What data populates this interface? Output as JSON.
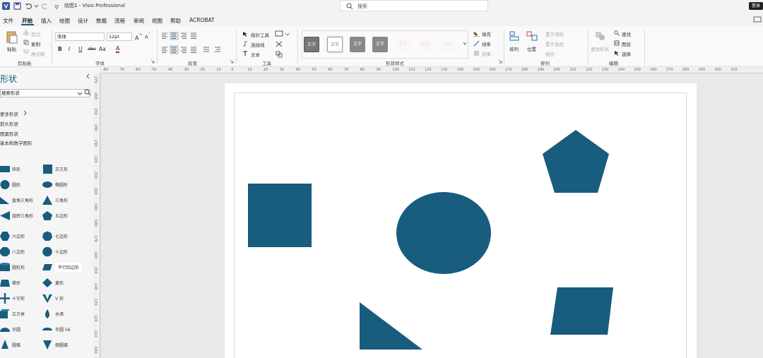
{
  "titlebar": {
    "doc_title": "绘图1 - Visio Professional",
    "search_placeholder": "搜索",
    "login": "登录"
  },
  "menu": [
    {
      "label": "文件"
    },
    {
      "label": "开始",
      "active": true
    },
    {
      "label": "插入"
    },
    {
      "label": "绘图"
    },
    {
      "label": "设计"
    },
    {
      "label": "数据"
    },
    {
      "label": "流程"
    },
    {
      "label": "审阅"
    },
    {
      "label": "视图"
    },
    {
      "label": "帮助"
    },
    {
      "label": "ACROBAT"
    }
  ],
  "ribbon": {
    "clipboard": {
      "paste": "粘贴",
      "cut": "剪切",
      "copy": "复制",
      "format_painter": "格式刷",
      "label": "剪贴板"
    },
    "font": {
      "font_name": "宋体",
      "font_size": "12pt",
      "bold": "B",
      "italic": "I",
      "underline": "U",
      "strike": "abc",
      "case": "Aa",
      "font_color": "A",
      "label": "字体"
    },
    "paragraph": {
      "label": "段落"
    },
    "tools": {
      "pointer": "指针工具",
      "connector": "连接线",
      "text": "文本",
      "label": "工具"
    },
    "shape_styles": {
      "swatches": [
        "文字",
        "文字",
        "文字",
        "文字",
        "文字",
        "文字",
        "文字"
      ],
      "fill": "填充",
      "line": "线条",
      "effects": "效果",
      "label": "形状样式"
    },
    "arrange": {
      "arrange": "排列",
      "position": "位置",
      "align": "置于顶层",
      "send": "置于底层",
      "group": "组合",
      "label": "排列"
    },
    "editing": {
      "change_shape": "更改形状",
      "find": "查找",
      "layers": "图层",
      "select": "选择",
      "label": "编辑"
    }
  },
  "shapes_pane": {
    "title": "形状",
    "search_placeholder": "搜索形状",
    "more_shapes": "更多形状",
    "stencils": [
      "箭头形状",
      "图案形状",
      "基本和数学图形"
    ],
    "items": [
      {
        "label": "矩形",
        "icon": "rectangle-icon"
      },
      {
        "label": "正方形",
        "icon": "square-icon"
      },
      {
        "label": "圆形",
        "icon": "circle-icon"
      },
      {
        "label": "椭圆形",
        "icon": "ellipse-icon"
      },
      {
        "label": "直角三角形",
        "icon": "right-triangle-icon"
      },
      {
        "label": "三角形",
        "icon": "triangle-icon"
      },
      {
        "label": "旋转三角形",
        "icon": "rotated-triangle-icon"
      },
      {
        "label": "五边形",
        "icon": "pentagon-icon"
      },
      {
        "label": "六边形",
        "icon": "hexagon-icon"
      },
      {
        "label": "七边形",
        "icon": "heptagon-icon"
      },
      {
        "label": "八边形",
        "icon": "octagon-icon"
      },
      {
        "label": "十边形",
        "icon": "decagon-icon"
      },
      {
        "label": "圆柱形",
        "icon": "cylinder-icon"
      },
      {
        "label": "平行四边形",
        "icon": "parallelogram-icon"
      },
      {
        "label": "梯形",
        "icon": "trapezoid-icon"
      },
      {
        "label": "菱形",
        "icon": "diamond-icon"
      },
      {
        "label": "十字形",
        "icon": "cross-icon"
      },
      {
        "label": "V 形",
        "icon": "chevron-icon"
      },
      {
        "label": "立方体",
        "icon": "cube-icon"
      },
      {
        "label": "水滴",
        "icon": "drop-icon"
      },
      {
        "label": "半圆",
        "icon": "semicircle-icon"
      },
      {
        "label": "半圆 56",
        "icon": "semicircle-56-icon"
      },
      {
        "label": "圆锥",
        "icon": "cone-icon"
      },
      {
        "label": "倒圆锥",
        "icon": "inverted-cone-icon"
      }
    ]
  },
  "ruler": {
    "top": [
      "-80",
      "-70",
      "-60",
      "-50",
      "-40",
      "-30",
      "-20",
      "-10",
      "0",
      "10",
      "20",
      "30",
      "40",
      "50",
      "60",
      "70",
      "80",
      "90",
      "100",
      "110",
      "120",
      "130",
      "140",
      "150",
      "160",
      "170",
      "180",
      "190",
      "200",
      "210",
      "220",
      "230",
      "240",
      "250",
      "260",
      "270",
      "280",
      "290",
      "300",
      "310"
    ],
    "left": [
      "270",
      "260",
      "250",
      "240",
      "230",
      "220",
      "210",
      "200",
      "190",
      "180",
      "170",
      "160",
      "150",
      "140",
      "130",
      "120",
      "110",
      "100"
    ]
  },
  "colors": {
    "shape_fill": "#185c7e",
    "accent": "#185c7e",
    "ribbon_bg": "#f9f9f9"
  },
  "canvas_shapes": [
    {
      "type": "square",
      "name": "square-shape"
    },
    {
      "type": "ellipse",
      "name": "circle-shape"
    },
    {
      "type": "pentagon",
      "name": "pentagon-shape"
    },
    {
      "type": "parallelogram",
      "name": "parallelogram-shape"
    },
    {
      "type": "right-triangle",
      "name": "right-triangle-shape"
    }
  ]
}
